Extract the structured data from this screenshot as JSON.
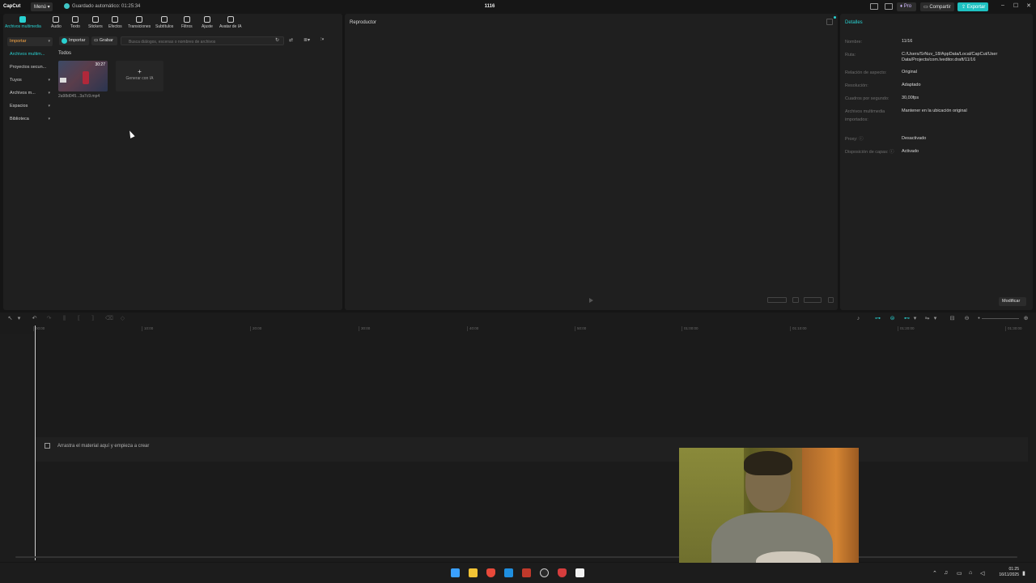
{
  "titlebar": {
    "logo": "CapCut",
    "menu_label": "Menú ▾",
    "autosave_text": "Guardado automático: 01:25:34",
    "project_title": "1116",
    "pro_label": "Pro",
    "share_label": "Compartir",
    "export_label": "Exportar",
    "window_controls": [
      "–",
      "☐",
      "✕"
    ]
  },
  "media_panel": {
    "tools": [
      {
        "label": "Archivos multimedia",
        "icon": "media-icon",
        "active": true
      },
      {
        "label": "Audio",
        "icon": "audio-icon"
      },
      {
        "label": "Texto",
        "icon": "text-icon"
      },
      {
        "label": "Stickers",
        "icon": "sticker-icon"
      },
      {
        "label": "Efectos",
        "icon": "effects-icon"
      },
      {
        "label": "Transiciones",
        "icon": "transitions-icon"
      },
      {
        "label": "Subtítulos",
        "icon": "subtitles-icon"
      },
      {
        "label": "Filtros",
        "icon": "filters-icon"
      },
      {
        "label": "Ajuste",
        "icon": "adjust-icon"
      },
      {
        "label": "Avatar de IA",
        "icon": "avatar-icon"
      }
    ],
    "sidebar": [
      {
        "label": "Importar",
        "chevron": "▾"
      },
      {
        "label": "Archivos multim..."
      },
      {
        "label": "Proyectos secun..."
      },
      {
        "label": "Tuyos",
        "chevron": "▾"
      },
      {
        "label": "Archivos m...",
        "chevron": "▾"
      },
      {
        "label": "Espacios",
        "chevron": "▾"
      },
      {
        "label": "Biblioteca",
        "chevron": "▾"
      }
    ],
    "import_btn": "Importar",
    "record_btn": "Grabar",
    "search_placeholder": "Busca diálogos, escenas o nombres de archivos",
    "filter_all": "Todos",
    "clip": {
      "duration": "30:27",
      "name": "2a98d045...3a7c9.mp4"
    },
    "generate_card": {
      "plus": "+",
      "label": "Generar con IA"
    }
  },
  "player": {
    "title": "Reproductor"
  },
  "details": {
    "title": "Detalles",
    "rows": [
      {
        "key": "Nombre:",
        "value": "11/16"
      },
      {
        "key": "Ruta:",
        "value": "C:/Users/SrNuv_18/AppData/Local/CapCut/User Data/Projects/com.lveditor.draft/11/16"
      },
      {
        "key": "Relación de aspecto:",
        "value": "Original"
      },
      {
        "key": "Resolución:",
        "value": "Adaptado"
      },
      {
        "key": "Cuadros por segundo:",
        "value": "30,00fps"
      },
      {
        "key": "Archivos multimedia importados:",
        "value": "Mantener en la ubicación original"
      },
      {
        "key": "Proxy: ⓘ",
        "value": "Desactivado"
      },
      {
        "key": "Disposición de capas: ⓘ",
        "value": "Activado"
      }
    ],
    "modify_btn": "Modificar"
  },
  "timeline": {
    "ruler_ticks": [
      "00:00",
      "10:00",
      "20:00",
      "30:00",
      "40:00",
      "50:00",
      "01:00:00",
      "01:10:00",
      "01:20:00",
      "01:30:00"
    ],
    "drop_hint": "Arrastra el material aquí y empieza a crear"
  },
  "taskbar": {
    "time": "01:25",
    "date": "16/11/2025"
  },
  "colors": {
    "accent": "#29d1d1",
    "panel": "#1f1f1f",
    "background": "#151515"
  }
}
